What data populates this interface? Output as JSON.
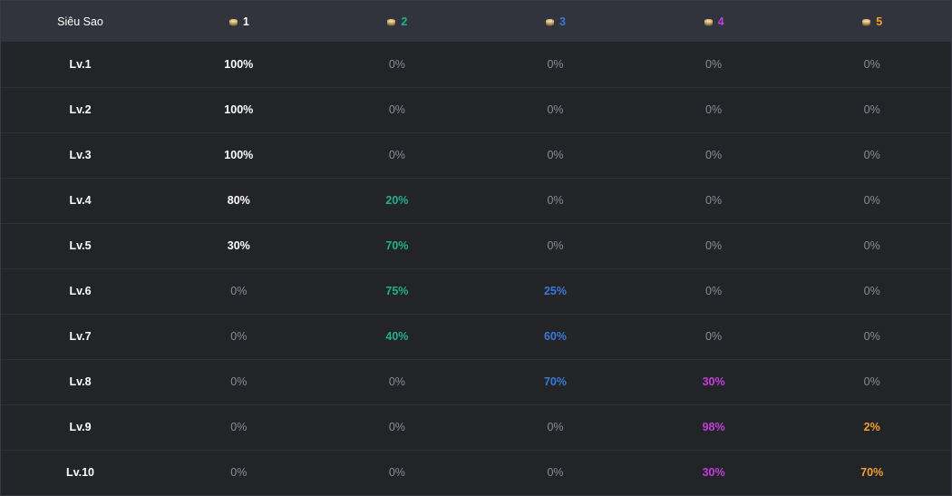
{
  "table": {
    "header_label": "Siêu Sao",
    "icon": "gold-coin-stack-icon",
    "tiers": [
      {
        "label": "1",
        "color": "#ffffff"
      },
      {
        "label": "2",
        "color": "#20b28a"
      },
      {
        "label": "3",
        "color": "#3b79d6"
      },
      {
        "label": "4",
        "color": "#c13fd9"
      },
      {
        "label": "5",
        "color": "#f0a130"
      }
    ],
    "rows": [
      {
        "level": "Lv.1",
        "values": [
          "100%",
          "0%",
          "0%",
          "0%",
          "0%"
        ]
      },
      {
        "level": "Lv.2",
        "values": [
          "100%",
          "0%",
          "0%",
          "0%",
          "0%"
        ]
      },
      {
        "level": "Lv.3",
        "values": [
          "100%",
          "0%",
          "0%",
          "0%",
          "0%"
        ]
      },
      {
        "level": "Lv.4",
        "values": [
          "80%",
          "20%",
          "0%",
          "0%",
          "0%"
        ]
      },
      {
        "level": "Lv.5",
        "values": [
          "30%",
          "70%",
          "0%",
          "0%",
          "0%"
        ]
      },
      {
        "level": "Lv.6",
        "values": [
          "0%",
          "75%",
          "25%",
          "0%",
          "0%"
        ]
      },
      {
        "level": "Lv.7",
        "values": [
          "0%",
          "40%",
          "60%",
          "0%",
          "0%"
        ]
      },
      {
        "level": "Lv.8",
        "values": [
          "0%",
          "0%",
          "70%",
          "30%",
          "0%"
        ]
      },
      {
        "level": "Lv.9",
        "values": [
          "0%",
          "0%",
          "0%",
          "98%",
          "2%"
        ]
      },
      {
        "level": "Lv.10",
        "values": [
          "0%",
          "0%",
          "0%",
          "30%",
          "70%"
        ]
      }
    ],
    "colors": {
      "background": "#232428",
      "header_background": "#31333d",
      "zero_value": "#8b8d93"
    }
  }
}
